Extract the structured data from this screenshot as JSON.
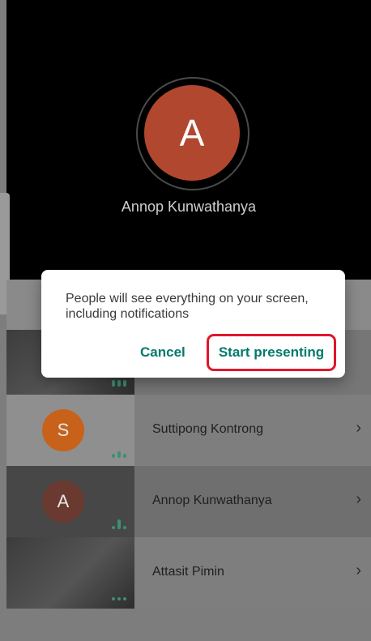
{
  "featured": {
    "initial": "A",
    "name": "Annop Kunwathanya",
    "avatar_color": "#b1472e"
  },
  "participants": [
    {
      "initial": "S",
      "name": "Suttipong Kontrong",
      "avatar_color": "#c8621a"
    },
    {
      "initial": "A",
      "name": "Annop Kunwathanya",
      "avatar_color": "#8a3a2a"
    },
    {
      "initial": "",
      "name": "Attasit Pimin",
      "avatar_color": ""
    }
  ],
  "dialog": {
    "message": "People will see everything on your screen, including notifications",
    "cancel_label": "Cancel",
    "start_label": "Start presenting",
    "accent_color": "#00796b",
    "highlight_color": "#e0162b"
  }
}
